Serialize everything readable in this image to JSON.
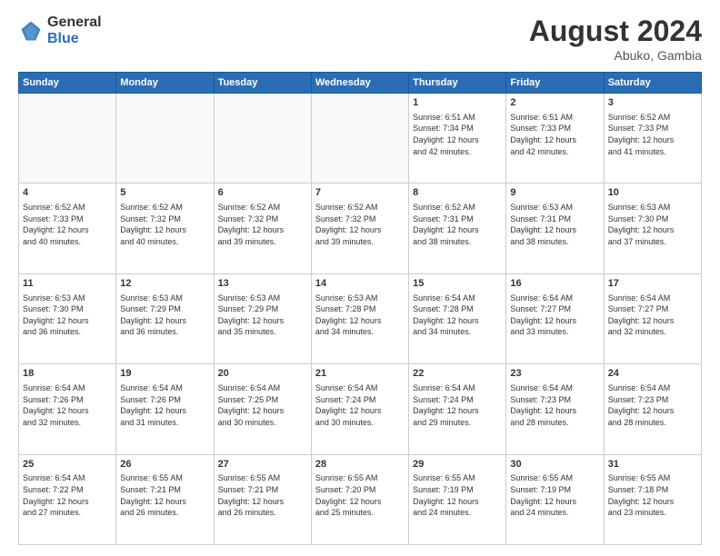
{
  "header": {
    "logo_general": "General",
    "logo_blue": "Blue",
    "month_year": "August 2024",
    "location": "Abuko, Gambia"
  },
  "weekdays": [
    "Sunday",
    "Monday",
    "Tuesday",
    "Wednesday",
    "Thursday",
    "Friday",
    "Saturday"
  ],
  "weeks": [
    [
      {
        "day": "",
        "content": ""
      },
      {
        "day": "",
        "content": ""
      },
      {
        "day": "",
        "content": ""
      },
      {
        "day": "",
        "content": ""
      },
      {
        "day": "1",
        "content": "Sunrise: 6:51 AM\nSunset: 7:34 PM\nDaylight: 12 hours\nand 42 minutes."
      },
      {
        "day": "2",
        "content": "Sunrise: 6:51 AM\nSunset: 7:33 PM\nDaylight: 12 hours\nand 42 minutes."
      },
      {
        "day": "3",
        "content": "Sunrise: 6:52 AM\nSunset: 7:33 PM\nDaylight: 12 hours\nand 41 minutes."
      }
    ],
    [
      {
        "day": "4",
        "content": "Sunrise: 6:52 AM\nSunset: 7:33 PM\nDaylight: 12 hours\nand 40 minutes."
      },
      {
        "day": "5",
        "content": "Sunrise: 6:52 AM\nSunset: 7:32 PM\nDaylight: 12 hours\nand 40 minutes."
      },
      {
        "day": "6",
        "content": "Sunrise: 6:52 AM\nSunset: 7:32 PM\nDaylight: 12 hours\nand 39 minutes."
      },
      {
        "day": "7",
        "content": "Sunrise: 6:52 AM\nSunset: 7:32 PM\nDaylight: 12 hours\nand 39 minutes."
      },
      {
        "day": "8",
        "content": "Sunrise: 6:52 AM\nSunset: 7:31 PM\nDaylight: 12 hours\nand 38 minutes."
      },
      {
        "day": "9",
        "content": "Sunrise: 6:53 AM\nSunset: 7:31 PM\nDaylight: 12 hours\nand 38 minutes."
      },
      {
        "day": "10",
        "content": "Sunrise: 6:53 AM\nSunset: 7:30 PM\nDaylight: 12 hours\nand 37 minutes."
      }
    ],
    [
      {
        "day": "11",
        "content": "Sunrise: 6:53 AM\nSunset: 7:30 PM\nDaylight: 12 hours\nand 36 minutes."
      },
      {
        "day": "12",
        "content": "Sunrise: 6:53 AM\nSunset: 7:29 PM\nDaylight: 12 hours\nand 36 minutes."
      },
      {
        "day": "13",
        "content": "Sunrise: 6:53 AM\nSunset: 7:29 PM\nDaylight: 12 hours\nand 35 minutes."
      },
      {
        "day": "14",
        "content": "Sunrise: 6:53 AM\nSunset: 7:28 PM\nDaylight: 12 hours\nand 34 minutes."
      },
      {
        "day": "15",
        "content": "Sunrise: 6:54 AM\nSunset: 7:28 PM\nDaylight: 12 hours\nand 34 minutes."
      },
      {
        "day": "16",
        "content": "Sunrise: 6:54 AM\nSunset: 7:27 PM\nDaylight: 12 hours\nand 33 minutes."
      },
      {
        "day": "17",
        "content": "Sunrise: 6:54 AM\nSunset: 7:27 PM\nDaylight: 12 hours\nand 32 minutes."
      }
    ],
    [
      {
        "day": "18",
        "content": "Sunrise: 6:54 AM\nSunset: 7:26 PM\nDaylight: 12 hours\nand 32 minutes."
      },
      {
        "day": "19",
        "content": "Sunrise: 6:54 AM\nSunset: 7:26 PM\nDaylight: 12 hours\nand 31 minutes."
      },
      {
        "day": "20",
        "content": "Sunrise: 6:54 AM\nSunset: 7:25 PM\nDaylight: 12 hours\nand 30 minutes."
      },
      {
        "day": "21",
        "content": "Sunrise: 6:54 AM\nSunset: 7:24 PM\nDaylight: 12 hours\nand 30 minutes."
      },
      {
        "day": "22",
        "content": "Sunrise: 6:54 AM\nSunset: 7:24 PM\nDaylight: 12 hours\nand 29 minutes."
      },
      {
        "day": "23",
        "content": "Sunrise: 6:54 AM\nSunset: 7:23 PM\nDaylight: 12 hours\nand 28 minutes."
      },
      {
        "day": "24",
        "content": "Sunrise: 6:54 AM\nSunset: 7:23 PM\nDaylight: 12 hours\nand 28 minutes."
      }
    ],
    [
      {
        "day": "25",
        "content": "Sunrise: 6:54 AM\nSunset: 7:22 PM\nDaylight: 12 hours\nand 27 minutes."
      },
      {
        "day": "26",
        "content": "Sunrise: 6:55 AM\nSunset: 7:21 PM\nDaylight: 12 hours\nand 26 minutes."
      },
      {
        "day": "27",
        "content": "Sunrise: 6:55 AM\nSunset: 7:21 PM\nDaylight: 12 hours\nand 26 minutes."
      },
      {
        "day": "28",
        "content": "Sunrise: 6:55 AM\nSunset: 7:20 PM\nDaylight: 12 hours\nand 25 minutes."
      },
      {
        "day": "29",
        "content": "Sunrise: 6:55 AM\nSunset: 7:19 PM\nDaylight: 12 hours\nand 24 minutes."
      },
      {
        "day": "30",
        "content": "Sunrise: 6:55 AM\nSunset: 7:19 PM\nDaylight: 12 hours\nand 24 minutes."
      },
      {
        "day": "31",
        "content": "Sunrise: 6:55 AM\nSunset: 7:18 PM\nDaylight: 12 hours\nand 23 minutes."
      }
    ]
  ]
}
